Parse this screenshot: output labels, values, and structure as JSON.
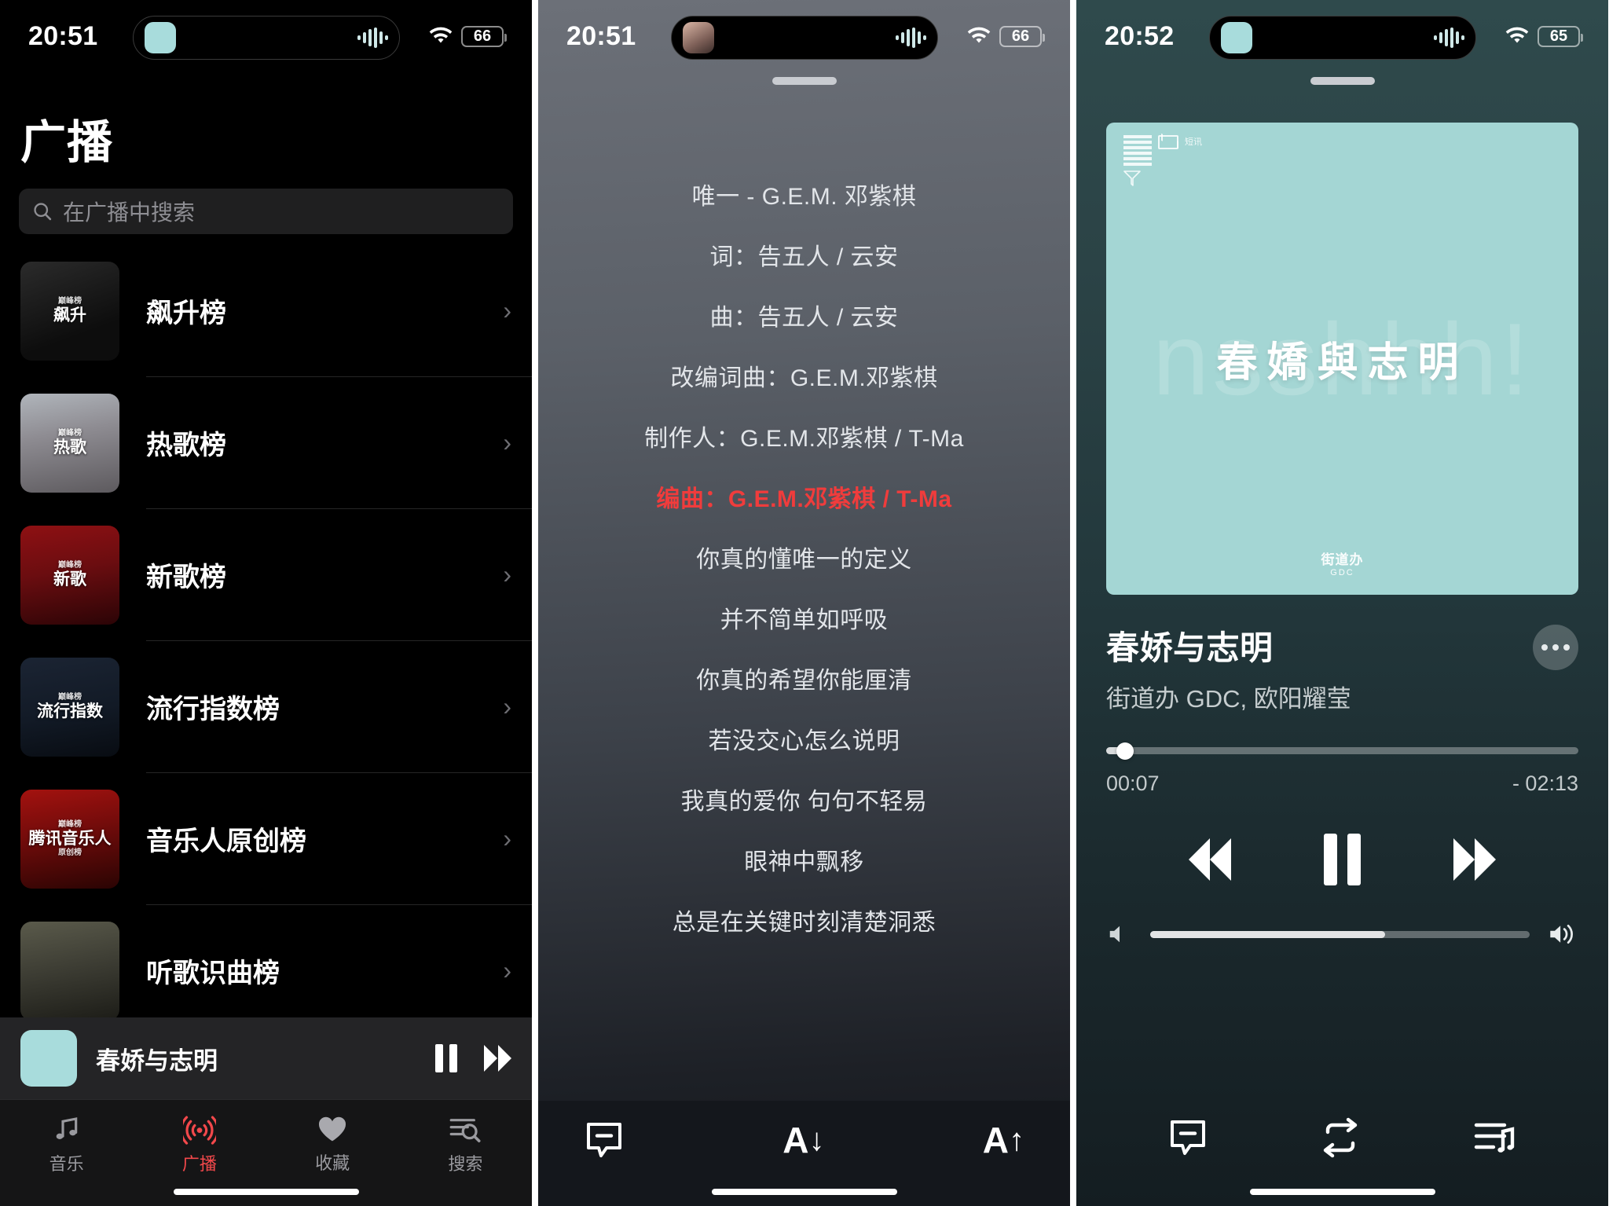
{
  "panels": {
    "radio": {
      "status": {
        "time": "20:51",
        "battery": "66",
        "wifi_icon": "wifi-icon",
        "island_wave_icon": "audio-wave-icon"
      },
      "page_title": "广播",
      "search": {
        "placeholder": "在广播中搜索",
        "icon": "search-icon"
      },
      "items": [
        {
          "label": "飙升榜",
          "art_caption": "飙升",
          "art_sub": "巅峰榜",
          "chevron": "›"
        },
        {
          "label": "热歌榜",
          "art_caption": "热歌",
          "art_sub": "巅峰榜",
          "chevron": "›"
        },
        {
          "label": "新歌榜",
          "art_caption": "新歌",
          "art_sub": "巅峰榜",
          "chevron": "›"
        },
        {
          "label": "流行指数榜",
          "art_caption": "流行指数",
          "art_sub": "巅峰榜",
          "chevron": "›"
        },
        {
          "label": "音乐人原创榜",
          "art_caption": "腾讯音乐人",
          "art_sub": "巅峰榜",
          "art_sub2": "原创榜",
          "chevron": "›"
        },
        {
          "label": "听歌识曲榜",
          "art_caption": "",
          "art_sub": "",
          "chevron": "›"
        }
      ],
      "mini_player": {
        "title": "春娇与志明",
        "pause_icon": "pause-icon",
        "next_icon": "fast-forward-icon"
      },
      "tabs": [
        {
          "label": "音乐",
          "icon": "music-note-icon",
          "active": false
        },
        {
          "label": "广播",
          "icon": "broadcast-icon",
          "active": true
        },
        {
          "label": "收藏",
          "icon": "heart-icon",
          "active": false
        },
        {
          "label": "搜索",
          "icon": "search-list-icon",
          "active": false
        }
      ]
    },
    "lyrics": {
      "status": {
        "time": "20:51",
        "battery": "66"
      },
      "grabber": "sheet-grabber",
      "lines": [
        {
          "text": "唯一 - G.E.M. 邓紫棋",
          "highlight": false
        },
        {
          "text": "词：告五人 / 云安",
          "highlight": false
        },
        {
          "text": "曲：告五人 / 云安",
          "highlight": false
        },
        {
          "text": "改编词曲：G.E.M.邓紫棋",
          "highlight": false
        },
        {
          "text": "制作人：G.E.M.邓紫棋 / T-Ma",
          "highlight": false
        },
        {
          "text": "编曲：G.E.M.邓紫棋 / T-Ma",
          "highlight": true
        },
        {
          "text": "你真的懂唯一的定义",
          "highlight": false
        },
        {
          "text": "并不简单如呼吸",
          "highlight": false
        },
        {
          "text": "你真的希望你能厘清",
          "highlight": false
        },
        {
          "text": "若没交心怎么说明",
          "highlight": false
        },
        {
          "text": "我真的爱你 句句不轻易",
          "highlight": false
        },
        {
          "text": "眼神中飘移",
          "highlight": false
        },
        {
          "text": "总是在关键时刻清楚洞悉",
          "highlight": false
        }
      ],
      "toolbar": [
        {
          "icon": "lyrics-offset-icon",
          "name": "subtitle-minus"
        },
        {
          "icon": "font-smaller-icon",
          "label": "A",
          "arrow": "↓"
        },
        {
          "icon": "font-larger-icon",
          "label": "A",
          "arrow": "↑"
        }
      ]
    },
    "now_playing": {
      "status": {
        "time": "20:52",
        "battery": "65"
      },
      "cover": {
        "ghost_text": "nsshhh!",
        "handwritten_title": "春嬌與志明",
        "brand": "街道办",
        "brand_sub": "GDC",
        "corner_label": "短讯"
      },
      "title": "春娇与志明",
      "artist": "街道办 GDC, 欧阳耀莹",
      "progress": {
        "elapsed": "00:07",
        "remaining": "- 02:13",
        "percent": 4
      },
      "volume_percent": 62,
      "transport": {
        "prev_icon": "rewind-icon",
        "pause_icon": "pause-icon",
        "next_icon": "fast-forward-icon",
        "vol_down_icon": "speaker-low-icon",
        "vol_up_icon": "speaker-high-icon"
      },
      "toolbar": [
        {
          "icon": "lyrics-icon",
          "name": "lyrics-toggle"
        },
        {
          "icon": "repeat-icon",
          "name": "repeat-mode"
        },
        {
          "icon": "queue-icon",
          "name": "play-queue"
        }
      ]
    }
  }
}
